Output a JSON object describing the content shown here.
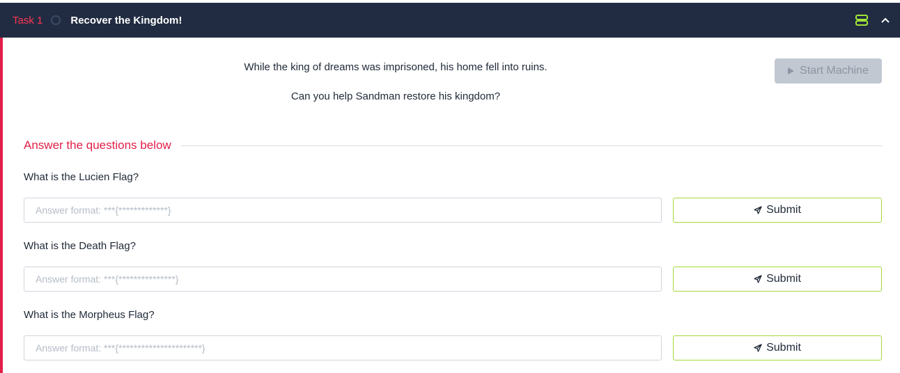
{
  "task": {
    "number_label": "Task 1",
    "title": "Recover the Kingdom!"
  },
  "intro": {
    "line1": "While the king of dreams was imprisoned, his home fell into ruins.",
    "line2": "Can you help Sandman restore his kingdom?"
  },
  "start_machine": {
    "label": "Start Machine",
    "icon": "play-icon"
  },
  "answers_heading": "Answer the questions below",
  "questions": [
    {
      "label": "What is the Lucien Flag?",
      "placeholder": "Answer format: ***{*************}",
      "submit_label": "Submit"
    },
    {
      "label": "What is the Death Flag?",
      "placeholder": "Answer format: ***{***************}",
      "submit_label": "Submit"
    },
    {
      "label": "What is the Morpheus Flag?",
      "placeholder": "Answer format: ***{**********************}",
      "submit_label": "Submit"
    }
  ],
  "icons": {
    "header_right": [
      "machine-icon",
      "chevron-up-icon"
    ],
    "status": "circle-status-icon",
    "submit": "send-icon"
  },
  "colors": {
    "header_bg": "#212c42",
    "accent_red": "#e11d48",
    "task_label_red": "#ff3553",
    "submit_border": "#a3d93a",
    "machine_icon": "#a3e635",
    "start_btn_bg": "#c2c8d1"
  }
}
